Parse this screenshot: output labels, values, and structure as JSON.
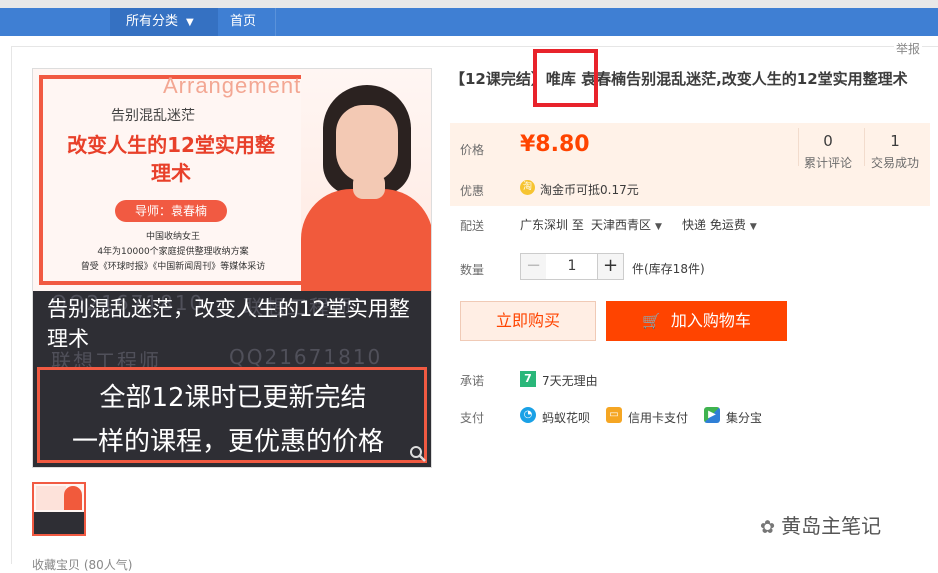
{
  "nav": {
    "category_label": "所有分类",
    "home_label": "首页"
  },
  "report_label": "举报",
  "product_image": {
    "arrangement": "Arrangement",
    "subtitle": "告别混乱迷茫",
    "big_title": "改变人生的12堂实用整理术",
    "teacher": "导师：袁春楠",
    "line1": "中国收纳女王",
    "line2": "4年为10000个家庭提供整理收纳方案",
    "line3": "曾受《环球时报》《中国新闻周刊》等媒体采访",
    "band_text": "告别混乱迷茫，改变人生的12堂实用整理术",
    "watermark_qq": "QQ21671810",
    "watermark_name": "联想工程师",
    "update_line1": "全部12课时已更新完结",
    "update_line2": "一样的课程，更优惠的价格"
  },
  "favorite_text": "收藏宝贝 (80人气)",
  "title": "【12课完结】唯库 袁春楠告别混乱迷茫,改变人生的12堂实用整理术",
  "price": {
    "label": "价格",
    "value": "¥8.80",
    "reviews_count": "0",
    "reviews_label": "累计评论",
    "sales_count": "1",
    "sales_label": "交易成功"
  },
  "promo": {
    "label": "优惠",
    "icon_text": "淘",
    "text": "淘金币可抵0.17元"
  },
  "shipping": {
    "label": "配送",
    "from_to": "广东深圳 至",
    "destination": "天津西青区",
    "method": "快递 免运费"
  },
  "quantity": {
    "label": "数量",
    "minus": "−",
    "value": "1",
    "plus": "+",
    "stock": "件(库存18件)"
  },
  "buttons": {
    "buy_now": "立即购买",
    "add_to_cart": "加入购物车"
  },
  "promise": {
    "label": "承诺",
    "icon_text": "7",
    "text": "7天无理由"
  },
  "payment": {
    "label": "支付",
    "methods": [
      "蚂蚁花呗",
      "信用卡支付",
      "集分宝"
    ]
  },
  "watermark_author": "黄岛主笔记",
  "colors": {
    "nav_blue": "#3f7fd3",
    "price_orange": "#ff4400",
    "highlight_red": "#e8232b"
  }
}
